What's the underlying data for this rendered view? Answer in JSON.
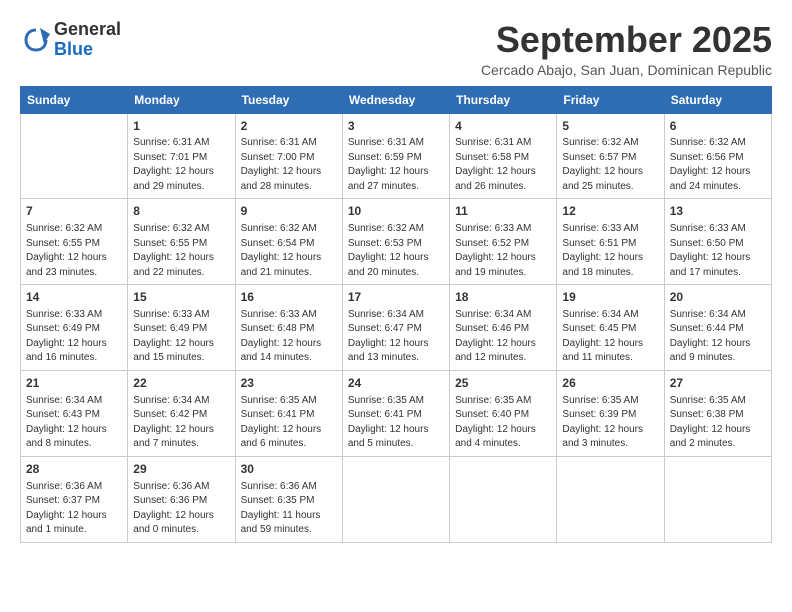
{
  "header": {
    "logo_general": "General",
    "logo_blue": "Blue",
    "month_title": "September 2025",
    "subtitle": "Cercado Abajo, San Juan, Dominican Republic"
  },
  "days_of_week": [
    "Sunday",
    "Monday",
    "Tuesday",
    "Wednesday",
    "Thursday",
    "Friday",
    "Saturday"
  ],
  "weeks": [
    [
      {
        "num": "",
        "info": ""
      },
      {
        "num": "1",
        "info": "Sunrise: 6:31 AM\nSunset: 7:01 PM\nDaylight: 12 hours\nand 29 minutes."
      },
      {
        "num": "2",
        "info": "Sunrise: 6:31 AM\nSunset: 7:00 PM\nDaylight: 12 hours\nand 28 minutes."
      },
      {
        "num": "3",
        "info": "Sunrise: 6:31 AM\nSunset: 6:59 PM\nDaylight: 12 hours\nand 27 minutes."
      },
      {
        "num": "4",
        "info": "Sunrise: 6:31 AM\nSunset: 6:58 PM\nDaylight: 12 hours\nand 26 minutes."
      },
      {
        "num": "5",
        "info": "Sunrise: 6:32 AM\nSunset: 6:57 PM\nDaylight: 12 hours\nand 25 minutes."
      },
      {
        "num": "6",
        "info": "Sunrise: 6:32 AM\nSunset: 6:56 PM\nDaylight: 12 hours\nand 24 minutes."
      }
    ],
    [
      {
        "num": "7",
        "info": "Sunrise: 6:32 AM\nSunset: 6:55 PM\nDaylight: 12 hours\nand 23 minutes."
      },
      {
        "num": "8",
        "info": "Sunrise: 6:32 AM\nSunset: 6:55 PM\nDaylight: 12 hours\nand 22 minutes."
      },
      {
        "num": "9",
        "info": "Sunrise: 6:32 AM\nSunset: 6:54 PM\nDaylight: 12 hours\nand 21 minutes."
      },
      {
        "num": "10",
        "info": "Sunrise: 6:32 AM\nSunset: 6:53 PM\nDaylight: 12 hours\nand 20 minutes."
      },
      {
        "num": "11",
        "info": "Sunrise: 6:33 AM\nSunset: 6:52 PM\nDaylight: 12 hours\nand 19 minutes."
      },
      {
        "num": "12",
        "info": "Sunrise: 6:33 AM\nSunset: 6:51 PM\nDaylight: 12 hours\nand 18 minutes."
      },
      {
        "num": "13",
        "info": "Sunrise: 6:33 AM\nSunset: 6:50 PM\nDaylight: 12 hours\nand 17 minutes."
      }
    ],
    [
      {
        "num": "14",
        "info": "Sunrise: 6:33 AM\nSunset: 6:49 PM\nDaylight: 12 hours\nand 16 minutes."
      },
      {
        "num": "15",
        "info": "Sunrise: 6:33 AM\nSunset: 6:49 PM\nDaylight: 12 hours\nand 15 minutes."
      },
      {
        "num": "16",
        "info": "Sunrise: 6:33 AM\nSunset: 6:48 PM\nDaylight: 12 hours\nand 14 minutes."
      },
      {
        "num": "17",
        "info": "Sunrise: 6:34 AM\nSunset: 6:47 PM\nDaylight: 12 hours\nand 13 minutes."
      },
      {
        "num": "18",
        "info": "Sunrise: 6:34 AM\nSunset: 6:46 PM\nDaylight: 12 hours\nand 12 minutes."
      },
      {
        "num": "19",
        "info": "Sunrise: 6:34 AM\nSunset: 6:45 PM\nDaylight: 12 hours\nand 11 minutes."
      },
      {
        "num": "20",
        "info": "Sunrise: 6:34 AM\nSunset: 6:44 PM\nDaylight: 12 hours\nand 9 minutes."
      }
    ],
    [
      {
        "num": "21",
        "info": "Sunrise: 6:34 AM\nSunset: 6:43 PM\nDaylight: 12 hours\nand 8 minutes."
      },
      {
        "num": "22",
        "info": "Sunrise: 6:34 AM\nSunset: 6:42 PM\nDaylight: 12 hours\nand 7 minutes."
      },
      {
        "num": "23",
        "info": "Sunrise: 6:35 AM\nSunset: 6:41 PM\nDaylight: 12 hours\nand 6 minutes."
      },
      {
        "num": "24",
        "info": "Sunrise: 6:35 AM\nSunset: 6:41 PM\nDaylight: 12 hours\nand 5 minutes."
      },
      {
        "num": "25",
        "info": "Sunrise: 6:35 AM\nSunset: 6:40 PM\nDaylight: 12 hours\nand 4 minutes."
      },
      {
        "num": "26",
        "info": "Sunrise: 6:35 AM\nSunset: 6:39 PM\nDaylight: 12 hours\nand 3 minutes."
      },
      {
        "num": "27",
        "info": "Sunrise: 6:35 AM\nSunset: 6:38 PM\nDaylight: 12 hours\nand 2 minutes."
      }
    ],
    [
      {
        "num": "28",
        "info": "Sunrise: 6:36 AM\nSunset: 6:37 PM\nDaylight: 12 hours\nand 1 minute."
      },
      {
        "num": "29",
        "info": "Sunrise: 6:36 AM\nSunset: 6:36 PM\nDaylight: 12 hours\nand 0 minutes."
      },
      {
        "num": "30",
        "info": "Sunrise: 6:36 AM\nSunset: 6:35 PM\nDaylight: 11 hours\nand 59 minutes."
      },
      {
        "num": "",
        "info": ""
      },
      {
        "num": "",
        "info": ""
      },
      {
        "num": "",
        "info": ""
      },
      {
        "num": "",
        "info": ""
      }
    ]
  ]
}
